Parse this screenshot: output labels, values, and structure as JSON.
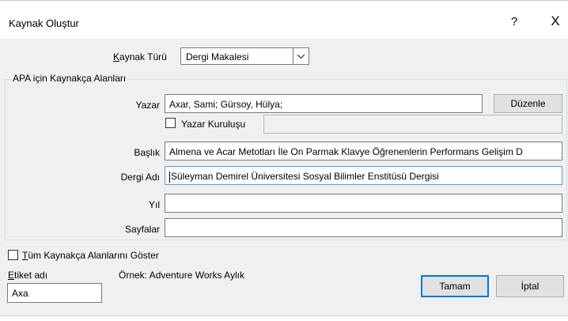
{
  "window": {
    "title": "Kaynak Oluştur",
    "help": "?",
    "close": "X"
  },
  "source_type": {
    "label": "Kaynak Türü",
    "value": "Dergi Makalesi"
  },
  "group": {
    "title": "APA için Kaynakça Alanları"
  },
  "author": {
    "label": "Yazar",
    "value": "Axar, Sami; Gürsoy, Hülya;",
    "edit_button": "Düzenle"
  },
  "corporate_author": {
    "label": "Yazar Kuruluşu",
    "value": ""
  },
  "fields": [
    {
      "label": "Başlık",
      "value": "Almena ve Acar Metotları İle On Parmak Klavye Öğrenenlerin Performans Gelişim D"
    },
    {
      "label": "Dergi Adı",
      "value": "Süleyman Demirel Üniversitesi Sosyal Bilimler Enstitüsü Dergisi"
    },
    {
      "label": "Yıl",
      "value": ""
    },
    {
      "label": "Sayfalar",
      "value": ""
    }
  ],
  "show_all": {
    "label": "Tüm Kaynakça Alanlarını Göster"
  },
  "tag": {
    "label": "Etiket adı",
    "value": "Axa"
  },
  "example": {
    "text": "Örnek: Adventure Works Aylık"
  },
  "buttons": {
    "ok": "Tamam",
    "cancel": "İptal"
  },
  "colors": {
    "accent": "#0078d7",
    "dialog_bg": "#f0f0f0",
    "focus_border": "#5a9bd5"
  },
  "icons": {
    "dropdown": "chevron-down-icon",
    "close": "close-icon",
    "help": "help-icon"
  }
}
